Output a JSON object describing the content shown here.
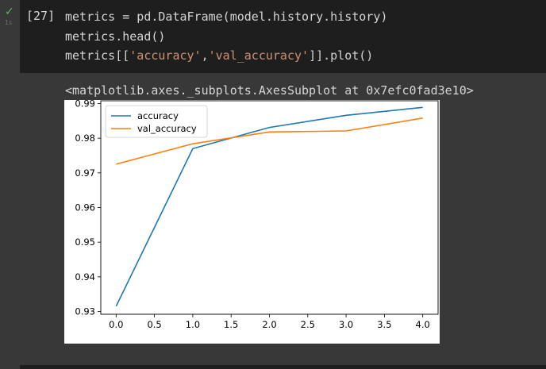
{
  "cell": {
    "status_icon": "check-icon",
    "run_time": "1s",
    "execution_count": "[27]",
    "code_lines": [
      "metrics = pd.DataFrame(model.history.history)",
      "metrics.head()"
    ],
    "line3_prefix": "metrics[[",
    "line3_str1": "'accuracy'",
    "line3_comma": ",",
    "line3_str2": "'val_accuracy'",
    "line3_suffix": "]].plot()"
  },
  "output": {
    "repr_text": "<matplotlib.axes._subplots.AxesSubplot at 0x7efc0fad3e10>"
  },
  "chart_data": {
    "type": "line",
    "title": "",
    "xlabel": "",
    "ylabel": "",
    "x": [
      0,
      1,
      2,
      3,
      4
    ],
    "xlim": [
      -0.2,
      4.2
    ],
    "ylim": [
      0.9292,
      0.9908
    ],
    "xticks": [
      "0.0",
      "0.5",
      "1.0",
      "1.5",
      "2.0",
      "2.5",
      "3.0",
      "3.5",
      "4.0"
    ],
    "yticks": [
      "0.93",
      "0.94",
      "0.95",
      "0.96",
      "0.97",
      "0.98",
      "0.99"
    ],
    "grid": false,
    "legend": "upper left",
    "series": [
      {
        "name": "accuracy",
        "color": "#1f77b4",
        "values": [
          0.9315,
          0.977,
          0.9831,
          0.9866,
          0.9889
        ]
      },
      {
        "name": "val_accuracy",
        "color": "#ff7f0e",
        "values": [
          0.9725,
          0.9784,
          0.9818,
          0.9821,
          0.9858
        ]
      }
    ]
  }
}
